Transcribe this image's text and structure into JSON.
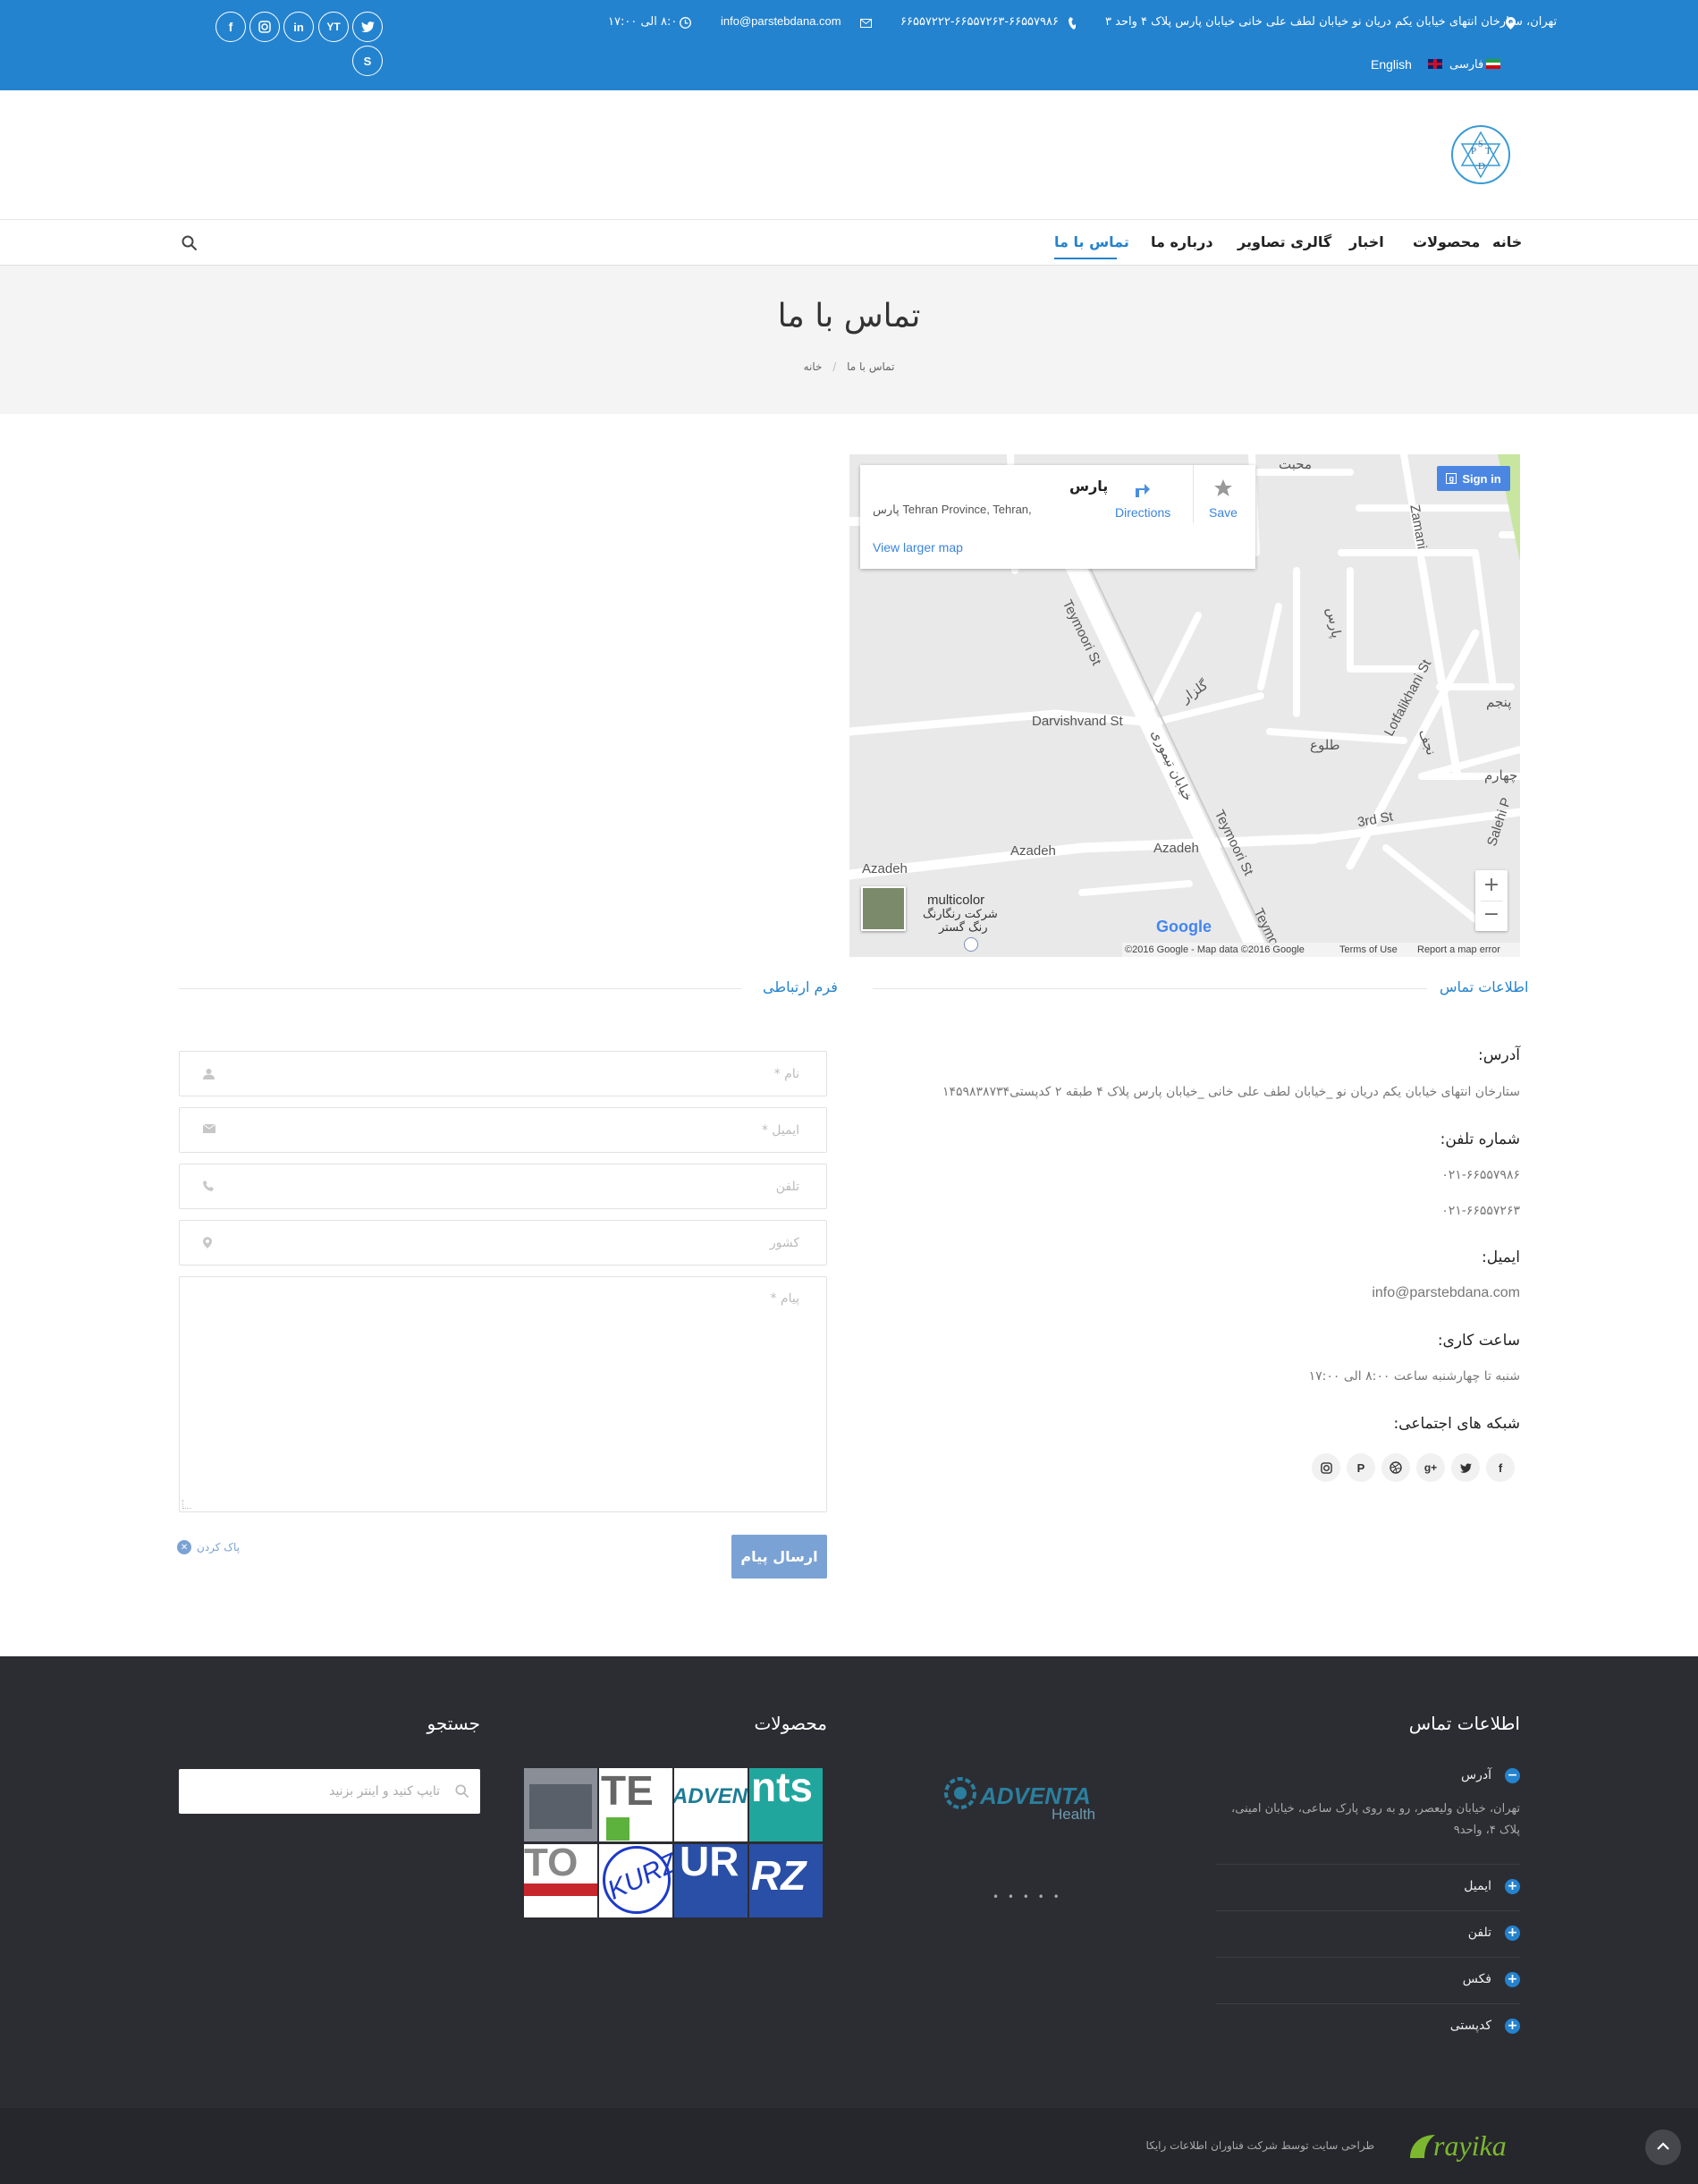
{
  "topbar": {
    "address": "تهران، ستارخان انتهای خیابان یکم دریان نو خیابان لطف علی خانی خیابان پارس پلاک ۴ واحد ۳",
    "phones": "۶۶۵۵۷۲۲۲-۶۶۵۵۷۲۶۳-۶۶۵۵۷۹۸۶",
    "email": "info@parstebdana.com",
    "hours": "۸:۰۰ الی ۱۷:۰۰",
    "lang_fa": "فارسی",
    "lang_en": "English"
  },
  "nav": {
    "items": [
      "خانه",
      "محصولات",
      "اخبار",
      "گالری تصاویر",
      "درباره ما",
      "تماس با ما"
    ]
  },
  "page": {
    "title": "تماس با ما",
    "breadcrumb_current": "تماس با ما",
    "breadcrumb_home": "خانه"
  },
  "map": {
    "place_name": "پارس",
    "place_address": "پارس Tehran Province, Tehran,",
    "directions": "Directions",
    "save": "Save",
    "view_larger": "View larger map",
    "sign_in": "Sign in",
    "attribution": "©2016 Google - Map data ©2016 Google",
    "terms": "Terms of Use",
    "report": "Report a map error",
    "logo": "Google",
    "poi": "multicolor",
    "poi_fa1": "شرکت رنگارنگ",
    "poi_fa2": "رنگ گستر",
    "streets": {
      "teymoori": "Teymoori St",
      "darvishvand": "Darvishvand St",
      "lotfalikhani": "Lotfalikhani St",
      "azadeh1": "Azadeh",
      "azadeh2": "Azadeh",
      "azadeh3": "Azadeh",
      "third": "3rd St",
      "teymoori2": "Teymoori St",
      "zamani": "Zamani",
      "salehi": "Salehi P",
      "golzar": "گلزار",
      "tolou": "طلوع",
      "pars": "پارس",
      "teymoori_fa": "خیابان تیموری",
      "najaf": "نجف",
      "mohebbat": "محبت",
      "jahar": "چهارم",
      "panjom": "پنجم",
      "teymoor3": "Teymo"
    }
  },
  "contact_info": {
    "section_title": "اطلاعات تماس",
    "address_label": "آدرس:",
    "address_value": "ستارخان انتهای خیابان یکم دریان نو _خیابان لطف علی خانی _خیابان پارس پلاک ۴ طبقه ۲ کدپستی۱۴۵۹۸۳۸۷۳۴",
    "phone_label": "شماره تلفن:",
    "phone1": "۰۲۱-۶۶۵۵۷۹۸۶",
    "phone2": "۰۲۱-۶۶۵۵۷۲۶۳",
    "email_label": "ایمیل:",
    "email_value": "info@parstebdana.com",
    "hours_label": "ساعت کاری:",
    "hours_value": "شنبه تا چهارشنبه ساعت ۸:۰۰ الی ۱۷:۰۰",
    "social_label": "شبکه های اجتماعی:"
  },
  "form": {
    "section_title": "فرم ارتباطی",
    "name_placeholder": "نام *",
    "email_placeholder": "ایمیل *",
    "phone_placeholder": "تلفن",
    "country_placeholder": "کشور",
    "message_placeholder": "پیام *",
    "submit": "ارسال پیام",
    "clear": "پاک کردن"
  },
  "footer": {
    "contact_title": "اطلاعات تماس",
    "products_title": "محصولات",
    "search_title": "جستجو",
    "search_placeholder": "تایپ کنید و اینتر بزنید",
    "accordion": {
      "address_label": "آدرس",
      "address_text": "تهران، خیابان ولیعصر، رو به روی پارک ساعی، خیابان امینی، پلاک ۴، واحد۹",
      "email_label": "ایمیل",
      "phone_label": "تلفن",
      "fax_label": "فکس",
      "postal_label": "کدپستی"
    },
    "adventa_logo": "ADVENTA",
    "adventa_sub": "Health",
    "slider_dots": "• • • • •",
    "thumbs": [
      "",
      "TE",
      "ADVENTA",
      "nts",
      "TO",
      "KURZ",
      "UR",
      "RZ"
    ],
    "credit": "طراحی سایت توسط شرکت فناوران اطلاعات رایکا",
    "raika_logo": "rayika"
  },
  "colors": {
    "brand_blue": "#2483cf",
    "footer_bg": "#2c2d33",
    "button_blue": "#7ba2d4"
  }
}
